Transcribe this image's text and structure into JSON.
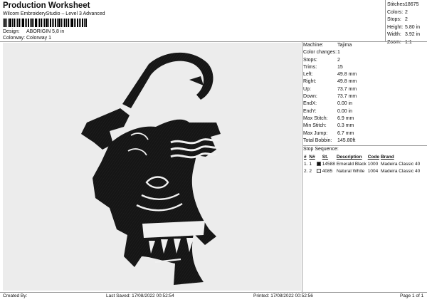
{
  "header": {
    "title": "Production Worksheet",
    "subtitle": "Wilcom EmbroideryStudio – Level 3 Advanced",
    "barcode_suffix": "1"
  },
  "meta": {
    "design_label": "Design:",
    "design_value": "ABORIGIN 5,8 in",
    "colorway_label": "Colorway:",
    "colorway_value": "Colorway 1"
  },
  "stats": [
    {
      "label": "Stitches:",
      "value": "18675"
    },
    {
      "label": "Colors:",
      "value": "2"
    },
    {
      "label": "Stops:",
      "value": "2"
    },
    {
      "label": "Height:",
      "value": "5.80 in"
    },
    {
      "label": "Width:",
      "value": "3.92 in"
    },
    {
      "label": "Zoom:",
      "value": "1:1"
    }
  ],
  "machine_info": [
    {
      "label": "Machine:",
      "value": "Tajima"
    },
    {
      "label": "Color changes:",
      "value": "1"
    },
    {
      "label": "Stops:",
      "value": "2"
    },
    {
      "label": "Trims:",
      "value": "15"
    },
    {
      "label": "Left:",
      "value": "49.8 mm"
    },
    {
      "label": "Right:",
      "value": "49.8 mm"
    },
    {
      "label": "Up:",
      "value": "73.7 mm"
    },
    {
      "label": "Down:",
      "value": "73.7 mm"
    },
    {
      "label": "EndX:",
      "value": "0.00 in"
    },
    {
      "label": "EndY:",
      "value": "0.00 in"
    },
    {
      "label": "Max Stitch:",
      "value": "6.9 mm"
    },
    {
      "label": "Min Stitch:",
      "value": "0.3 mm"
    },
    {
      "label": "Max Jump:",
      "value": "6.7 mm"
    },
    {
      "label": "Total Bobbin:",
      "value": "145.80ft"
    }
  ],
  "stop_sequence": {
    "heading": "Stop Sequence:",
    "columns": [
      "#",
      "N#",
      "St.",
      "Description",
      "Code",
      "Brand"
    ],
    "rows": [
      {
        "num": "1.",
        "n": "1",
        "color": "#111111",
        "st": "14588",
        "description": "Emerald Black",
        "code": "1000",
        "brand": "Madeira Classic 40"
      },
      {
        "num": "2.",
        "n": "2",
        "color": "#f4f4f4",
        "st": "4085",
        "description": "Natural White",
        "code": "1004",
        "brand": "Madeira Classic 40"
      }
    ]
  },
  "footer": {
    "created_by": "Created By:",
    "last_saved": "Last Saved: 17/08/2022 00:52:54",
    "printed": "Printed: 17/08/2022 00:52:56",
    "page": "Page 1 of 1"
  },
  "colors": {
    "design_background": "#ececec",
    "embroidery_black": "#151515",
    "embroidery_white": "#f0f0f0"
  }
}
